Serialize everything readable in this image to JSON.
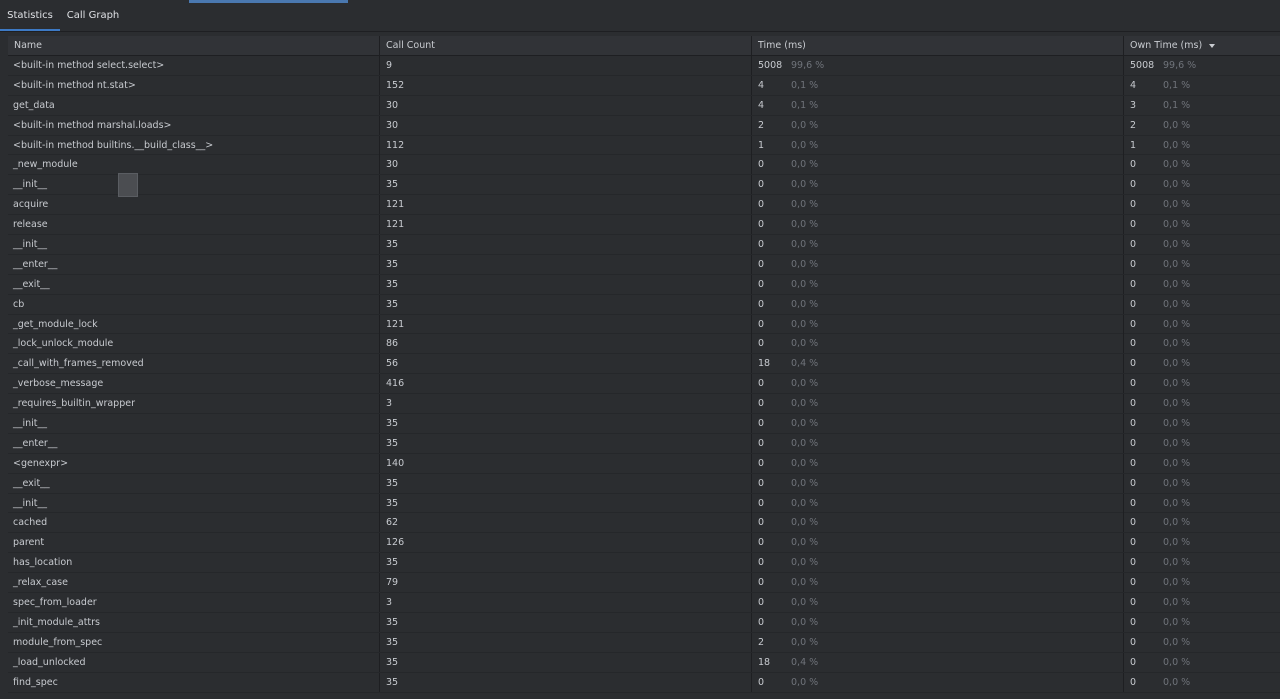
{
  "tabs": [
    {
      "label": "Statistics",
      "active": true
    },
    {
      "label": "Call Graph",
      "active": false
    }
  ],
  "columns": {
    "name": "Name",
    "call_count": "Call Count",
    "time": "Time (ms)",
    "own_time": "Own Time (ms)"
  },
  "sort": {
    "column": "own_time",
    "direction": "descending"
  },
  "rows": [
    {
      "name": "<built-in method select.select>",
      "count": "9",
      "time": "5008",
      "time_pct": "99,6 %",
      "own": "5008",
      "own_pct": "99,6 %"
    },
    {
      "name": "<built-in method nt.stat>",
      "count": "152",
      "time": "4",
      "time_pct": "0,1 %",
      "own": "4",
      "own_pct": "0,1 %"
    },
    {
      "name": "get_data",
      "count": "30",
      "time": "4",
      "time_pct": "0,1 %",
      "own": "3",
      "own_pct": "0,1 %"
    },
    {
      "name": "<built-in method marshal.loads>",
      "count": "30",
      "time": "2",
      "time_pct": "0,0 %",
      "own": "2",
      "own_pct": "0,0 %"
    },
    {
      "name": "<built-in method builtins.__build_class__>",
      "count": "112",
      "time": "1",
      "time_pct": "0,0 %",
      "own": "1",
      "own_pct": "0,0 %"
    },
    {
      "name": "_new_module",
      "count": "30",
      "time": "0",
      "time_pct": "0,0 %",
      "own": "0",
      "own_pct": "0,0 %"
    },
    {
      "name": "__init__",
      "count": "35",
      "time": "0",
      "time_pct": "0,0 %",
      "own": "0",
      "own_pct": "0,0 %"
    },
    {
      "name": "acquire",
      "count": "121",
      "time": "0",
      "time_pct": "0,0 %",
      "own": "0",
      "own_pct": "0,0 %"
    },
    {
      "name": "release",
      "count": "121",
      "time": "0",
      "time_pct": "0,0 %",
      "own": "0",
      "own_pct": "0,0 %"
    },
    {
      "name": "__init__",
      "count": "35",
      "time": "0",
      "time_pct": "0,0 %",
      "own": "0",
      "own_pct": "0,0 %"
    },
    {
      "name": "__enter__",
      "count": "35",
      "time": "0",
      "time_pct": "0,0 %",
      "own": "0",
      "own_pct": "0,0 %"
    },
    {
      "name": "__exit__",
      "count": "35",
      "time": "0",
      "time_pct": "0,0 %",
      "own": "0",
      "own_pct": "0,0 %"
    },
    {
      "name": "cb",
      "count": "35",
      "time": "0",
      "time_pct": "0,0 %",
      "own": "0",
      "own_pct": "0,0 %"
    },
    {
      "name": "_get_module_lock",
      "count": "121",
      "time": "0",
      "time_pct": "0,0 %",
      "own": "0",
      "own_pct": "0,0 %"
    },
    {
      "name": "_lock_unlock_module",
      "count": "86",
      "time": "0",
      "time_pct": "0,0 %",
      "own": "0",
      "own_pct": "0,0 %"
    },
    {
      "name": "_call_with_frames_removed",
      "count": "56",
      "time": "18",
      "time_pct": "0,4 %",
      "own": "0",
      "own_pct": "0,0 %"
    },
    {
      "name": "_verbose_message",
      "count": "416",
      "time": "0",
      "time_pct": "0,0 %",
      "own": "0",
      "own_pct": "0,0 %"
    },
    {
      "name": "_requires_builtin_wrapper",
      "count": "3",
      "time": "0",
      "time_pct": "0,0 %",
      "own": "0",
      "own_pct": "0,0 %"
    },
    {
      "name": "__init__",
      "count": "35",
      "time": "0",
      "time_pct": "0,0 %",
      "own": "0",
      "own_pct": "0,0 %"
    },
    {
      "name": "__enter__",
      "count": "35",
      "time": "0",
      "time_pct": "0,0 %",
      "own": "0",
      "own_pct": "0,0 %"
    },
    {
      "name": "<genexpr>",
      "count": "140",
      "time": "0",
      "time_pct": "0,0 %",
      "own": "0",
      "own_pct": "0,0 %"
    },
    {
      "name": "__exit__",
      "count": "35",
      "time": "0",
      "time_pct": "0,0 %",
      "own": "0",
      "own_pct": "0,0 %"
    },
    {
      "name": "__init__",
      "count": "35",
      "time": "0",
      "time_pct": "0,0 %",
      "own": "0",
      "own_pct": "0,0 %"
    },
    {
      "name": "cached",
      "count": "62",
      "time": "0",
      "time_pct": "0,0 %",
      "own": "0",
      "own_pct": "0,0 %"
    },
    {
      "name": "parent",
      "count": "126",
      "time": "0",
      "time_pct": "0,0 %",
      "own": "0",
      "own_pct": "0,0 %"
    },
    {
      "name": "has_location",
      "count": "35",
      "time": "0",
      "time_pct": "0,0 %",
      "own": "0",
      "own_pct": "0,0 %"
    },
    {
      "name": "_relax_case",
      "count": "79",
      "time": "0",
      "time_pct": "0,0 %",
      "own": "0",
      "own_pct": "0,0 %"
    },
    {
      "name": "spec_from_loader",
      "count": "3",
      "time": "0",
      "time_pct": "0,0 %",
      "own": "0",
      "own_pct": "0,0 %"
    },
    {
      "name": "_init_module_attrs",
      "count": "35",
      "time": "0",
      "time_pct": "0,0 %",
      "own": "0",
      "own_pct": "0,0 %"
    },
    {
      "name": "module_from_spec",
      "count": "35",
      "time": "2",
      "time_pct": "0,0 %",
      "own": "0",
      "own_pct": "0,0 %"
    },
    {
      "name": "_load_unlocked",
      "count": "35",
      "time": "18",
      "time_pct": "0,4 %",
      "own": "0",
      "own_pct": "0,0 %"
    },
    {
      "name": "find_spec",
      "count": "35",
      "time": "0",
      "time_pct": "0,0 %",
      "own": "0",
      "own_pct": "0,0 %"
    }
  ]
}
